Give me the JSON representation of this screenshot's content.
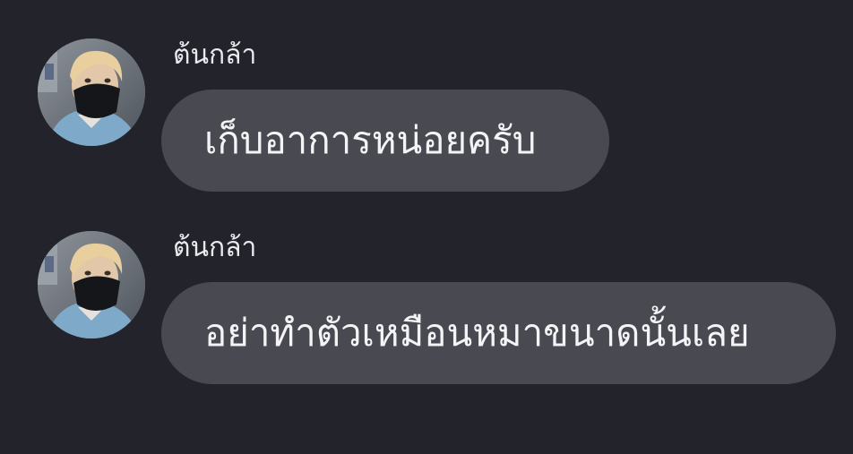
{
  "colors": {
    "background": "#23232b",
    "bubble": "#494951",
    "name_text": "#e9e9ee",
    "message_text": "#f4f4f6"
  },
  "messages": [
    {
      "sender": "ต้นกล้า",
      "text": "เก็บอาการหน่อยครับ",
      "avatar_icon": "profile-photo-masked-person"
    },
    {
      "sender": "ต้นกล้า",
      "text": "อย่าทำตัวเหมือนหมาขนาดนั้นเลย",
      "avatar_icon": "profile-photo-masked-person"
    }
  ]
}
